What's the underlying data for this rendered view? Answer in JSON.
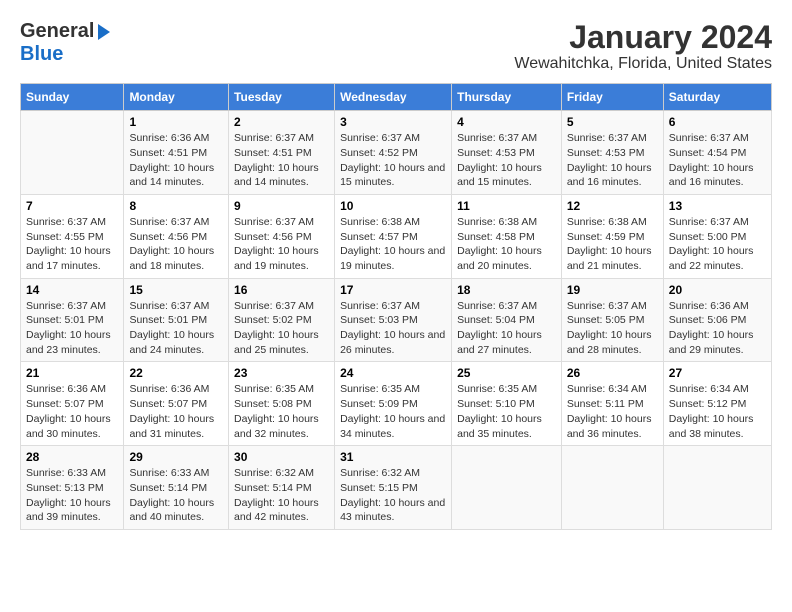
{
  "header": {
    "logo_general": "General",
    "logo_blue": "Blue",
    "title": "January 2024",
    "subtitle": "Wewahitchka, Florida, United States"
  },
  "days_of_week": [
    "Sunday",
    "Monday",
    "Tuesday",
    "Wednesday",
    "Thursday",
    "Friday",
    "Saturday"
  ],
  "weeks": [
    [
      {
        "num": "",
        "sunrise": "",
        "sunset": "",
        "daylight": ""
      },
      {
        "num": "1",
        "sunrise": "Sunrise: 6:36 AM",
        "sunset": "Sunset: 4:51 PM",
        "daylight": "Daylight: 10 hours and 14 minutes."
      },
      {
        "num": "2",
        "sunrise": "Sunrise: 6:37 AM",
        "sunset": "Sunset: 4:51 PM",
        "daylight": "Daylight: 10 hours and 14 minutes."
      },
      {
        "num": "3",
        "sunrise": "Sunrise: 6:37 AM",
        "sunset": "Sunset: 4:52 PM",
        "daylight": "Daylight: 10 hours and 15 minutes."
      },
      {
        "num": "4",
        "sunrise": "Sunrise: 6:37 AM",
        "sunset": "Sunset: 4:53 PM",
        "daylight": "Daylight: 10 hours and 15 minutes."
      },
      {
        "num": "5",
        "sunrise": "Sunrise: 6:37 AM",
        "sunset": "Sunset: 4:53 PM",
        "daylight": "Daylight: 10 hours and 16 minutes."
      },
      {
        "num": "6",
        "sunrise": "Sunrise: 6:37 AM",
        "sunset": "Sunset: 4:54 PM",
        "daylight": "Daylight: 10 hours and 16 minutes."
      }
    ],
    [
      {
        "num": "7",
        "sunrise": "Sunrise: 6:37 AM",
        "sunset": "Sunset: 4:55 PM",
        "daylight": "Daylight: 10 hours and 17 minutes."
      },
      {
        "num": "8",
        "sunrise": "Sunrise: 6:37 AM",
        "sunset": "Sunset: 4:56 PM",
        "daylight": "Daylight: 10 hours and 18 minutes."
      },
      {
        "num": "9",
        "sunrise": "Sunrise: 6:37 AM",
        "sunset": "Sunset: 4:56 PM",
        "daylight": "Daylight: 10 hours and 19 minutes."
      },
      {
        "num": "10",
        "sunrise": "Sunrise: 6:38 AM",
        "sunset": "Sunset: 4:57 PM",
        "daylight": "Daylight: 10 hours and 19 minutes."
      },
      {
        "num": "11",
        "sunrise": "Sunrise: 6:38 AM",
        "sunset": "Sunset: 4:58 PM",
        "daylight": "Daylight: 10 hours and 20 minutes."
      },
      {
        "num": "12",
        "sunrise": "Sunrise: 6:38 AM",
        "sunset": "Sunset: 4:59 PM",
        "daylight": "Daylight: 10 hours and 21 minutes."
      },
      {
        "num": "13",
        "sunrise": "Sunrise: 6:37 AM",
        "sunset": "Sunset: 5:00 PM",
        "daylight": "Daylight: 10 hours and 22 minutes."
      }
    ],
    [
      {
        "num": "14",
        "sunrise": "Sunrise: 6:37 AM",
        "sunset": "Sunset: 5:01 PM",
        "daylight": "Daylight: 10 hours and 23 minutes."
      },
      {
        "num": "15",
        "sunrise": "Sunrise: 6:37 AM",
        "sunset": "Sunset: 5:01 PM",
        "daylight": "Daylight: 10 hours and 24 minutes."
      },
      {
        "num": "16",
        "sunrise": "Sunrise: 6:37 AM",
        "sunset": "Sunset: 5:02 PM",
        "daylight": "Daylight: 10 hours and 25 minutes."
      },
      {
        "num": "17",
        "sunrise": "Sunrise: 6:37 AM",
        "sunset": "Sunset: 5:03 PM",
        "daylight": "Daylight: 10 hours and 26 minutes."
      },
      {
        "num": "18",
        "sunrise": "Sunrise: 6:37 AM",
        "sunset": "Sunset: 5:04 PM",
        "daylight": "Daylight: 10 hours and 27 minutes."
      },
      {
        "num": "19",
        "sunrise": "Sunrise: 6:37 AM",
        "sunset": "Sunset: 5:05 PM",
        "daylight": "Daylight: 10 hours and 28 minutes."
      },
      {
        "num": "20",
        "sunrise": "Sunrise: 6:36 AM",
        "sunset": "Sunset: 5:06 PM",
        "daylight": "Daylight: 10 hours and 29 minutes."
      }
    ],
    [
      {
        "num": "21",
        "sunrise": "Sunrise: 6:36 AM",
        "sunset": "Sunset: 5:07 PM",
        "daylight": "Daylight: 10 hours and 30 minutes."
      },
      {
        "num": "22",
        "sunrise": "Sunrise: 6:36 AM",
        "sunset": "Sunset: 5:07 PM",
        "daylight": "Daylight: 10 hours and 31 minutes."
      },
      {
        "num": "23",
        "sunrise": "Sunrise: 6:35 AM",
        "sunset": "Sunset: 5:08 PM",
        "daylight": "Daylight: 10 hours and 32 minutes."
      },
      {
        "num": "24",
        "sunrise": "Sunrise: 6:35 AM",
        "sunset": "Sunset: 5:09 PM",
        "daylight": "Daylight: 10 hours and 34 minutes."
      },
      {
        "num": "25",
        "sunrise": "Sunrise: 6:35 AM",
        "sunset": "Sunset: 5:10 PM",
        "daylight": "Daylight: 10 hours and 35 minutes."
      },
      {
        "num": "26",
        "sunrise": "Sunrise: 6:34 AM",
        "sunset": "Sunset: 5:11 PM",
        "daylight": "Daylight: 10 hours and 36 minutes."
      },
      {
        "num": "27",
        "sunrise": "Sunrise: 6:34 AM",
        "sunset": "Sunset: 5:12 PM",
        "daylight": "Daylight: 10 hours and 38 minutes."
      }
    ],
    [
      {
        "num": "28",
        "sunrise": "Sunrise: 6:33 AM",
        "sunset": "Sunset: 5:13 PM",
        "daylight": "Daylight: 10 hours and 39 minutes."
      },
      {
        "num": "29",
        "sunrise": "Sunrise: 6:33 AM",
        "sunset": "Sunset: 5:14 PM",
        "daylight": "Daylight: 10 hours and 40 minutes."
      },
      {
        "num": "30",
        "sunrise": "Sunrise: 6:32 AM",
        "sunset": "Sunset: 5:14 PM",
        "daylight": "Daylight: 10 hours and 42 minutes."
      },
      {
        "num": "31",
        "sunrise": "Sunrise: 6:32 AM",
        "sunset": "Sunset: 5:15 PM",
        "daylight": "Daylight: 10 hours and 43 minutes."
      },
      {
        "num": "",
        "sunrise": "",
        "sunset": "",
        "daylight": ""
      },
      {
        "num": "",
        "sunrise": "",
        "sunset": "",
        "daylight": ""
      },
      {
        "num": "",
        "sunrise": "",
        "sunset": "",
        "daylight": ""
      }
    ]
  ]
}
